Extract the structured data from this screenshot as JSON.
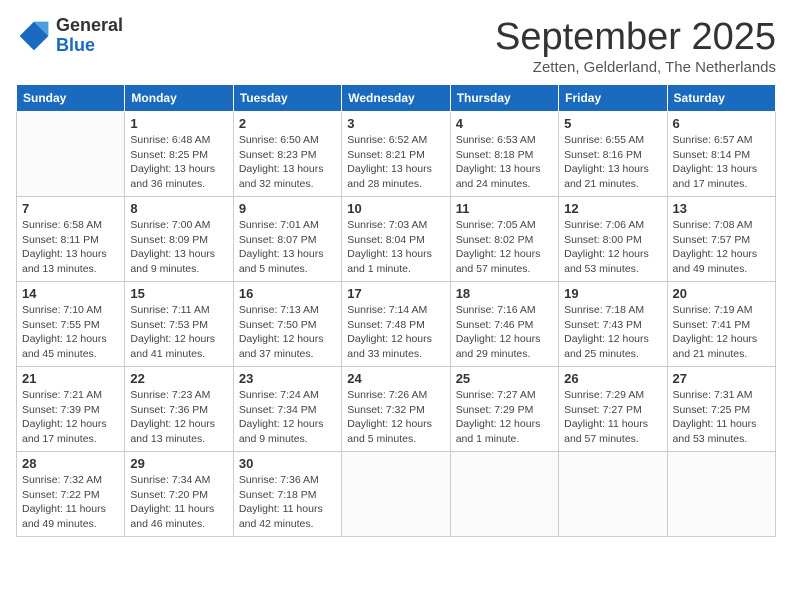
{
  "logo": {
    "general": "General",
    "blue": "Blue"
  },
  "title": "September 2025",
  "subtitle": "Zetten, Gelderland, The Netherlands",
  "days": [
    "Sunday",
    "Monday",
    "Tuesday",
    "Wednesday",
    "Thursday",
    "Friday",
    "Saturday"
  ],
  "weeks": [
    [
      {
        "num": "",
        "info": ""
      },
      {
        "num": "1",
        "info": "Sunrise: 6:48 AM\nSunset: 8:25 PM\nDaylight: 13 hours\nand 36 minutes."
      },
      {
        "num": "2",
        "info": "Sunrise: 6:50 AM\nSunset: 8:23 PM\nDaylight: 13 hours\nand 32 minutes."
      },
      {
        "num": "3",
        "info": "Sunrise: 6:52 AM\nSunset: 8:21 PM\nDaylight: 13 hours\nand 28 minutes."
      },
      {
        "num": "4",
        "info": "Sunrise: 6:53 AM\nSunset: 8:18 PM\nDaylight: 13 hours\nand 24 minutes."
      },
      {
        "num": "5",
        "info": "Sunrise: 6:55 AM\nSunset: 8:16 PM\nDaylight: 13 hours\nand 21 minutes."
      },
      {
        "num": "6",
        "info": "Sunrise: 6:57 AM\nSunset: 8:14 PM\nDaylight: 13 hours\nand 17 minutes."
      }
    ],
    [
      {
        "num": "7",
        "info": "Sunrise: 6:58 AM\nSunset: 8:11 PM\nDaylight: 13 hours\nand 13 minutes."
      },
      {
        "num": "8",
        "info": "Sunrise: 7:00 AM\nSunset: 8:09 PM\nDaylight: 13 hours\nand 9 minutes."
      },
      {
        "num": "9",
        "info": "Sunrise: 7:01 AM\nSunset: 8:07 PM\nDaylight: 13 hours\nand 5 minutes."
      },
      {
        "num": "10",
        "info": "Sunrise: 7:03 AM\nSunset: 8:04 PM\nDaylight: 13 hours\nand 1 minute."
      },
      {
        "num": "11",
        "info": "Sunrise: 7:05 AM\nSunset: 8:02 PM\nDaylight: 12 hours\nand 57 minutes."
      },
      {
        "num": "12",
        "info": "Sunrise: 7:06 AM\nSunset: 8:00 PM\nDaylight: 12 hours\nand 53 minutes."
      },
      {
        "num": "13",
        "info": "Sunrise: 7:08 AM\nSunset: 7:57 PM\nDaylight: 12 hours\nand 49 minutes."
      }
    ],
    [
      {
        "num": "14",
        "info": "Sunrise: 7:10 AM\nSunset: 7:55 PM\nDaylight: 12 hours\nand 45 minutes."
      },
      {
        "num": "15",
        "info": "Sunrise: 7:11 AM\nSunset: 7:53 PM\nDaylight: 12 hours\nand 41 minutes."
      },
      {
        "num": "16",
        "info": "Sunrise: 7:13 AM\nSunset: 7:50 PM\nDaylight: 12 hours\nand 37 minutes."
      },
      {
        "num": "17",
        "info": "Sunrise: 7:14 AM\nSunset: 7:48 PM\nDaylight: 12 hours\nand 33 minutes."
      },
      {
        "num": "18",
        "info": "Sunrise: 7:16 AM\nSunset: 7:46 PM\nDaylight: 12 hours\nand 29 minutes."
      },
      {
        "num": "19",
        "info": "Sunrise: 7:18 AM\nSunset: 7:43 PM\nDaylight: 12 hours\nand 25 minutes."
      },
      {
        "num": "20",
        "info": "Sunrise: 7:19 AM\nSunset: 7:41 PM\nDaylight: 12 hours\nand 21 minutes."
      }
    ],
    [
      {
        "num": "21",
        "info": "Sunrise: 7:21 AM\nSunset: 7:39 PM\nDaylight: 12 hours\nand 17 minutes."
      },
      {
        "num": "22",
        "info": "Sunrise: 7:23 AM\nSunset: 7:36 PM\nDaylight: 12 hours\nand 13 minutes."
      },
      {
        "num": "23",
        "info": "Sunrise: 7:24 AM\nSunset: 7:34 PM\nDaylight: 12 hours\nand 9 minutes."
      },
      {
        "num": "24",
        "info": "Sunrise: 7:26 AM\nSunset: 7:32 PM\nDaylight: 12 hours\nand 5 minutes."
      },
      {
        "num": "25",
        "info": "Sunrise: 7:27 AM\nSunset: 7:29 PM\nDaylight: 12 hours\nand 1 minute."
      },
      {
        "num": "26",
        "info": "Sunrise: 7:29 AM\nSunset: 7:27 PM\nDaylight: 11 hours\nand 57 minutes."
      },
      {
        "num": "27",
        "info": "Sunrise: 7:31 AM\nSunset: 7:25 PM\nDaylight: 11 hours\nand 53 minutes."
      }
    ],
    [
      {
        "num": "28",
        "info": "Sunrise: 7:32 AM\nSunset: 7:22 PM\nDaylight: 11 hours\nand 49 minutes."
      },
      {
        "num": "29",
        "info": "Sunrise: 7:34 AM\nSunset: 7:20 PM\nDaylight: 11 hours\nand 46 minutes."
      },
      {
        "num": "30",
        "info": "Sunrise: 7:36 AM\nSunset: 7:18 PM\nDaylight: 11 hours\nand 42 minutes."
      },
      {
        "num": "",
        "info": ""
      },
      {
        "num": "",
        "info": ""
      },
      {
        "num": "",
        "info": ""
      },
      {
        "num": "",
        "info": ""
      }
    ]
  ]
}
